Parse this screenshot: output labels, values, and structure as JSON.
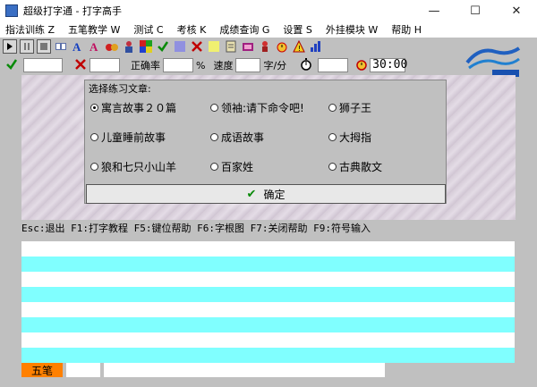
{
  "window": {
    "title": "超级打字通 - 打字高手",
    "minimize": "—",
    "maximize": "☐",
    "close": "✕"
  },
  "menu": [
    "指法训练 Z",
    "五笔教学 W",
    "测试 C",
    "考核 K",
    "成绩查询 G",
    "设置 S",
    "外挂模块 W",
    "帮助 H"
  ],
  "toolbar": {
    "icons": [
      "play-icon",
      "pause-icon",
      "stop-icon",
      "open-book-icon",
      "font-a-icon",
      "font-b-icon",
      "characters-icon",
      "person-icon",
      "color-palette-icon",
      "check-icon",
      "square-icon",
      "cross-icon",
      "yellow-square-icon",
      "clipboard-icon",
      "tv-icon",
      "figure-icon",
      "alarm-icon",
      "warning-icon",
      "chart-icon"
    ]
  },
  "stats": {
    "correct_count": "",
    "wrong_count": "",
    "accuracy_label": "正确率",
    "accuracy_value": "",
    "accuracy_unit": "%",
    "speed_label": "速度",
    "speed_value": "",
    "speed_unit": "字/分",
    "elapsed_value": "",
    "countdown_value": "30:00"
  },
  "dialog": {
    "legend": "选择练习文章:",
    "options": [
      "寓言故事２０篇",
      "领袖:请下命令吧!",
      "狮子王",
      "儿童睡前故事",
      "成语故事",
      "大拇指",
      "狼和七只小山羊",
      "百家姓",
      "古典散文"
    ],
    "selected_index": 0,
    "confirm_label": "确定"
  },
  "helpline": "Esc:退出  F1:打字教程  F5:键位帮助  F6:字根图  F7:关闭帮助  F9:符号输入",
  "bottom": {
    "ime_label": "五笔",
    "code_box": "",
    "message_box": ""
  },
  "colors": {
    "ime_bg": "#ff8000",
    "line_cyan": "#80ffff",
    "check_green": "#0a8a0a",
    "cross_red": "#c00000"
  }
}
